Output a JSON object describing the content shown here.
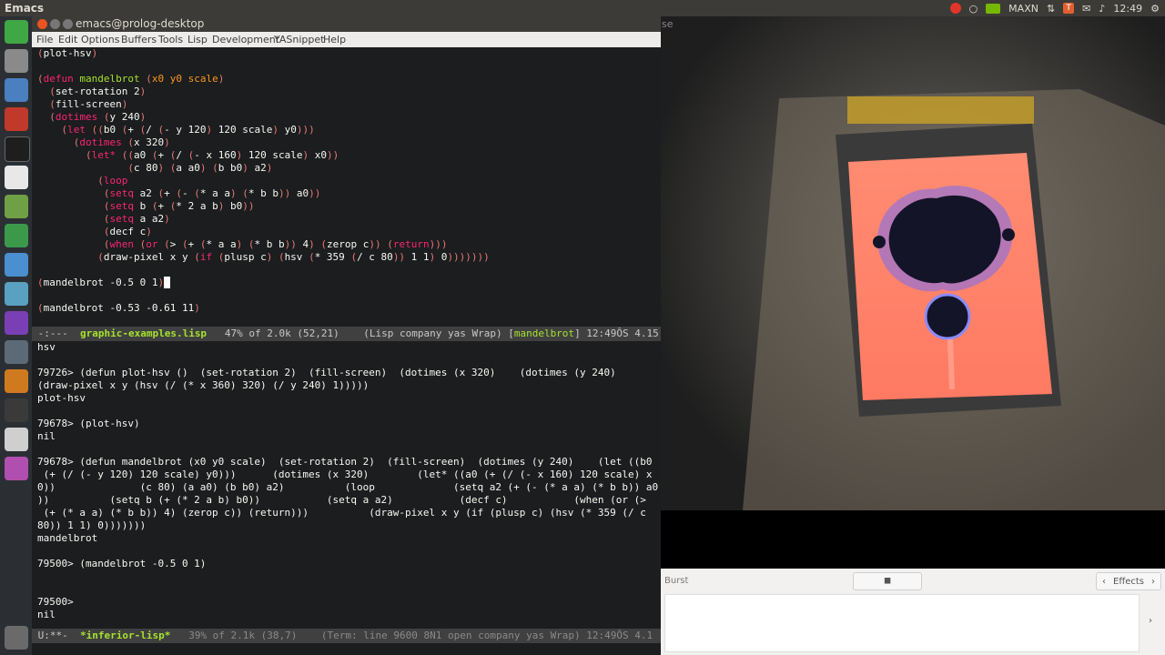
{
  "top_panel": {
    "app_name": "Emacs",
    "indicator_label": "MAXN",
    "clock": "12:49"
  },
  "window": {
    "title": "emacs@prolog-desktop",
    "menu": [
      "File",
      "Edit",
      "Options",
      "Buffers",
      "Tools",
      "Lisp",
      "Development",
      "YASnippet",
      "Help"
    ]
  },
  "top_modeline": {
    "status": " -:---  ",
    "buffer_name": "graphic-examples.lisp",
    "position": "   47% of 2.0k (52,21)    ",
    "modes": "(Lisp company yas Wrap) [",
    "function": "mandelbrot",
    "tail": "] 12:49ÔS 4.15"
  },
  "bottom_modeline": {
    "status": " U:**-  ",
    "buffer_name": "*inferior-lisp*",
    "position": "   39% of 2.1k (38,7)    ",
    "modes": "(Term: line 9600 8N1 open company yas Wrap) 12:49ÔS 4.1"
  },
  "repl": {
    "lines": [
      "hsv",
      "",
      "79726> (defun plot-hsv ()  (set-rotation 2)  (fill-screen)  (dotimes (x 320)    (dotimes (y 240)",
      "(draw-pixel x y (hsv (/ (* x 360) 320) (/ y 240) 1)))))",
      "plot-hsv",
      "",
      "79678> (plot-hsv)",
      "nil",
      "",
      "79678> (defun mandelbrot (x0 y0 scale)  (set-rotation 2)  (fill-screen)  (dotimes (y 240)    (let ((b0",
      " (+ (/ (- y 120) 120 scale) y0)))      (dotimes (x 320)        (let* ((a0 (+ (/ (- x 160) 120 scale) x",
      "0))              (c 80) (a a0) (b b0) a2)          (loop             (setq a2 (+ (- (* a a) (* b b)) a0",
      "))          (setq b (+ (* 2 a b) b0))           (setq a a2)           (decf c)           (when (or (>",
      " (+ (* a a) (* b b)) 4) (zerop c)) (return)))          (draw-pixel x y (if (plusp c) (hsv (* 359 (/ c",
      "80)) 1 1) 0)))))))",
      "mandelbrot",
      "",
      "79500> (mandelbrot -0.5 0 1)",
      "",
      "",
      "79500>",
      "nil"
    ]
  },
  "gallery": {
    "burst_label": "Burst",
    "effects_label": "Effects",
    "left_chevron": "‹",
    "right_chevron": "›",
    "shutter_glyph": "◼"
  },
  "partial_text": "se",
  "colors": {
    "screen_orange": "#ff8a70",
    "mandelbrot_body": "#141428",
    "editor_bg": "#1b1d1e"
  }
}
